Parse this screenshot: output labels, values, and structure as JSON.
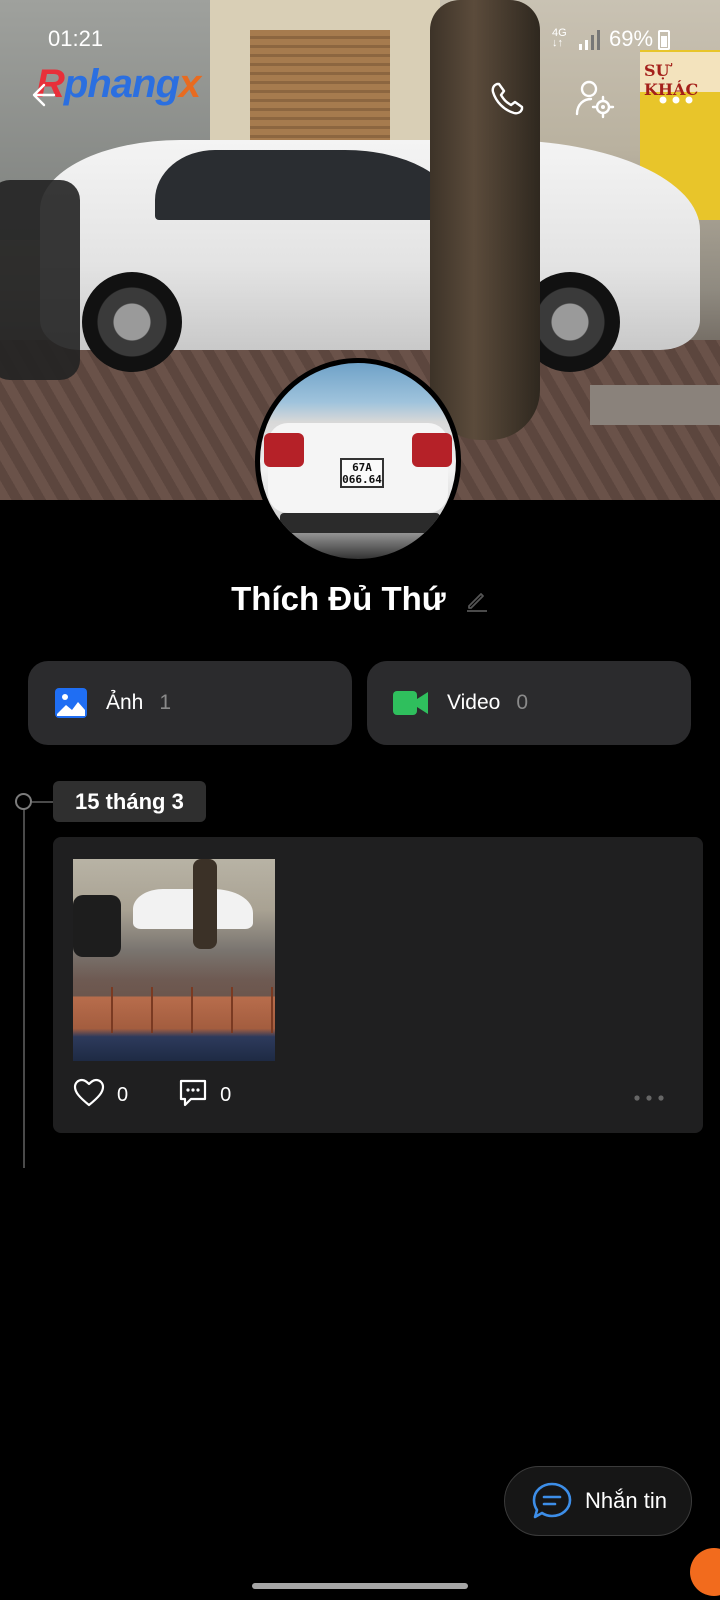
{
  "status_bar": {
    "time": "01:21",
    "network": "4G",
    "battery": "69%"
  },
  "watermark": {
    "part1": "R",
    "part2": "phang",
    "part3": "x"
  },
  "cover": {
    "shop_sign": "SỰ KHÁC"
  },
  "avatar": {
    "plate_line1": "67A",
    "plate_line2": "066.64"
  },
  "profile": {
    "name": "Thích Đủ Thứ"
  },
  "media": {
    "photos_label": "Ảnh",
    "photos_count": "1",
    "video_label": "Video",
    "video_count": "0"
  },
  "timeline": {
    "date": "15 tháng 3",
    "post": {
      "likes": "0",
      "comments": "0"
    }
  },
  "message_button": {
    "label": "Nhắn tin"
  },
  "colors": {
    "photos_icon": "#1f6ef3",
    "video_icon": "#2fbf5d",
    "message_icon": "#3d8ee8",
    "card_bg": "#2b2b2d"
  }
}
